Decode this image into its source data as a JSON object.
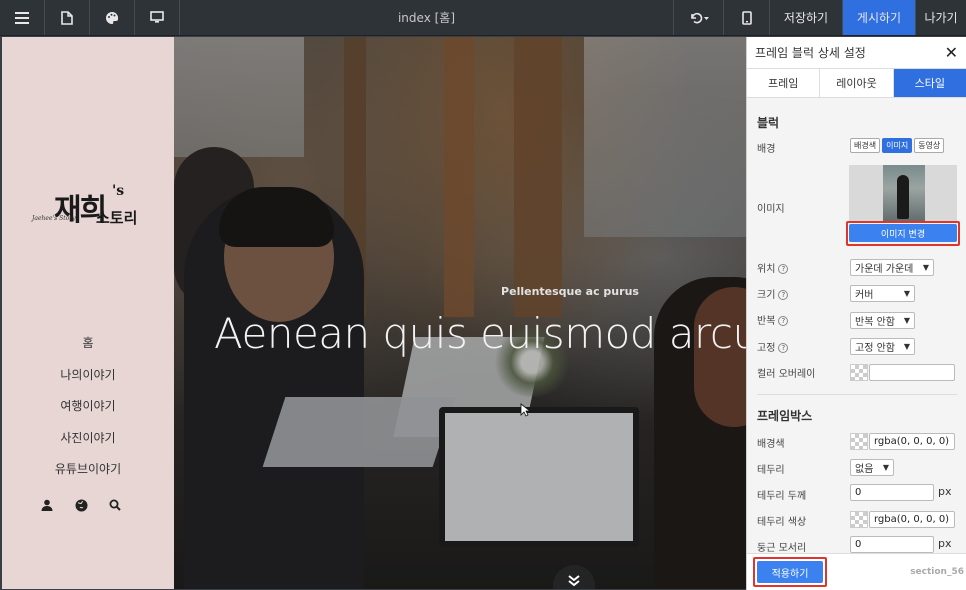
{
  "topbar": {
    "title": "index [홈]",
    "save_label": "저장하기",
    "publish_label": "게시하기",
    "exit_label": "나가기"
  },
  "sidebar": {
    "logo_main": "재희",
    "logo_s": "'s",
    "logo_story": "스토리",
    "logo_sig": "Jaehee's Story",
    "nav_items": [
      "홈",
      "나의이야기",
      "여행이야기",
      "사진이야기",
      "유튜브이야기"
    ],
    "icons": [
      "user-icon",
      "globe-icon",
      "search-icon"
    ]
  },
  "hero": {
    "subtitle": "Pellentesque ac purus",
    "title": "Aenean quis euismod arcu."
  },
  "panel": {
    "title": "프레임 블럭 상세 설정",
    "tabs": [
      "프레임",
      "레이아웃",
      "스타일"
    ],
    "active_tab": "스타일",
    "block": {
      "heading": "블럭",
      "bg_label": "배경",
      "bg_options": [
        "배경색",
        "이미지",
        "동영상"
      ],
      "bg_selected": "이미지",
      "image_label": "이미지",
      "change_image_label": "이미지 변경",
      "position_label": "위치",
      "position_value": "가운데 가운데",
      "size_label": "크기",
      "size_value": "커버",
      "repeat_label": "반복",
      "repeat_value": "반복 안함",
      "fixed_label": "고정",
      "fixed_value": "고정 안함",
      "overlay_label": "컬러 오버레이",
      "overlay_value": ""
    },
    "framebox": {
      "heading": "프레임박스",
      "bg_color_label": "배경색",
      "bg_color_value": "rgba(0, 0, 0, 0)",
      "border_label": "테두리",
      "border_value": "없음",
      "border_width_label": "테두리 두께",
      "border_width_value": "0",
      "border_color_label": "테두리 색상",
      "border_color_value": "rgba(0, 0, 0, 0)",
      "radius_label": "둥근 모서리",
      "radius_value": "0",
      "unit": "px"
    },
    "apply_label": "적용하기",
    "section_id": "section_56"
  },
  "colors": {
    "accent": "#2f6fe0",
    "topbar": "#2e3338",
    "sidebar": "#e7d6d4",
    "highlight": "#e0352b"
  }
}
